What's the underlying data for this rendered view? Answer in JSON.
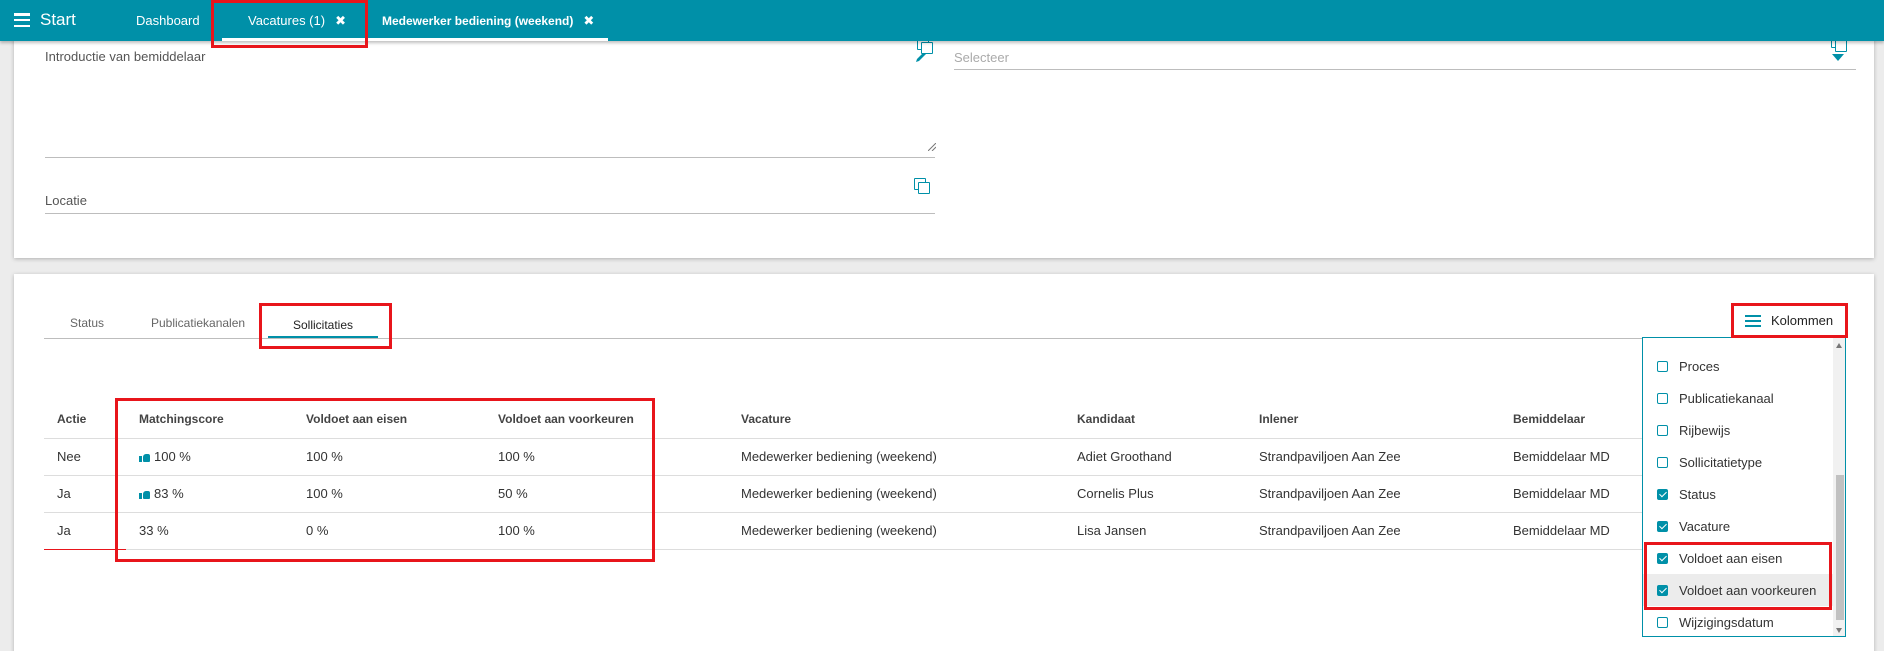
{
  "topbar": {
    "menu_label": "Start",
    "tabs": [
      {
        "label": "Dashboard"
      },
      {
        "label": "Vacatures (1)",
        "close": "✖"
      },
      {
        "label": "Medewerker bediening (weekend)",
        "close": "✖"
      }
    ]
  },
  "form": {
    "introductie_label": "Introductie van bemiddelaar",
    "locatie_label": "Locatie",
    "select_placeholder": "Selecteer"
  },
  "subtabs": [
    "Status",
    "Publicatiekanalen",
    "Sollicitaties"
  ],
  "kolommen_label": "Kolommen",
  "table": {
    "headers": [
      "Actie",
      "Matchingscore",
      "Voldoet aan eisen",
      "Voldoet aan voorkeuren",
      "Vacature",
      "Kandidaat",
      "Inlener",
      "Bemiddelaar"
    ],
    "rows": [
      {
        "actie": "Nee",
        "score": "100 %",
        "thumb": true,
        "eisen": "100 %",
        "voorkeuren": "100 %",
        "vacature": "Medewerker bediening (weekend)",
        "kandidaat": "Adiet Groothand",
        "inlener": "Strandpaviljoen Aan Zee",
        "bemiddelaar": "Bemiddelaar MD"
      },
      {
        "actie": "Ja",
        "score": "83 %",
        "thumb": true,
        "eisen": "100 %",
        "voorkeuren": "50 %",
        "vacature": "Medewerker bediening (weekend)",
        "kandidaat": "Cornelis Plus",
        "inlener": "Strandpaviljoen Aan Zee",
        "bemiddelaar": "Bemiddelaar MD"
      },
      {
        "actie": "Ja",
        "score": "33 %",
        "thumb": false,
        "eisen": "0 %",
        "voorkeuren": "100 %",
        "vacature": "Medewerker bediening (weekend)",
        "kandidaat": "Lisa Jansen",
        "inlener": "Strandpaviljoen Aan Zee",
        "bemiddelaar": "Bemiddelaar MD"
      }
    ]
  },
  "columns_menu": [
    {
      "label": "Proces",
      "checked": false
    },
    {
      "label": "Publicatiekanaal",
      "checked": false
    },
    {
      "label": "Rijbewijs",
      "checked": false
    },
    {
      "label": "Sollicitatietype",
      "checked": false
    },
    {
      "label": "Status",
      "checked": true
    },
    {
      "label": "Vacature",
      "checked": true
    },
    {
      "label": "Voldoet aan eisen",
      "checked": true
    },
    {
      "label": "Voldoet aan voorkeuren",
      "checked": true
    },
    {
      "label": "Wijzigingsdatum",
      "checked": false
    }
  ],
  "colors": {
    "primary": "#0090a8",
    "highlight": "#e8151b"
  }
}
